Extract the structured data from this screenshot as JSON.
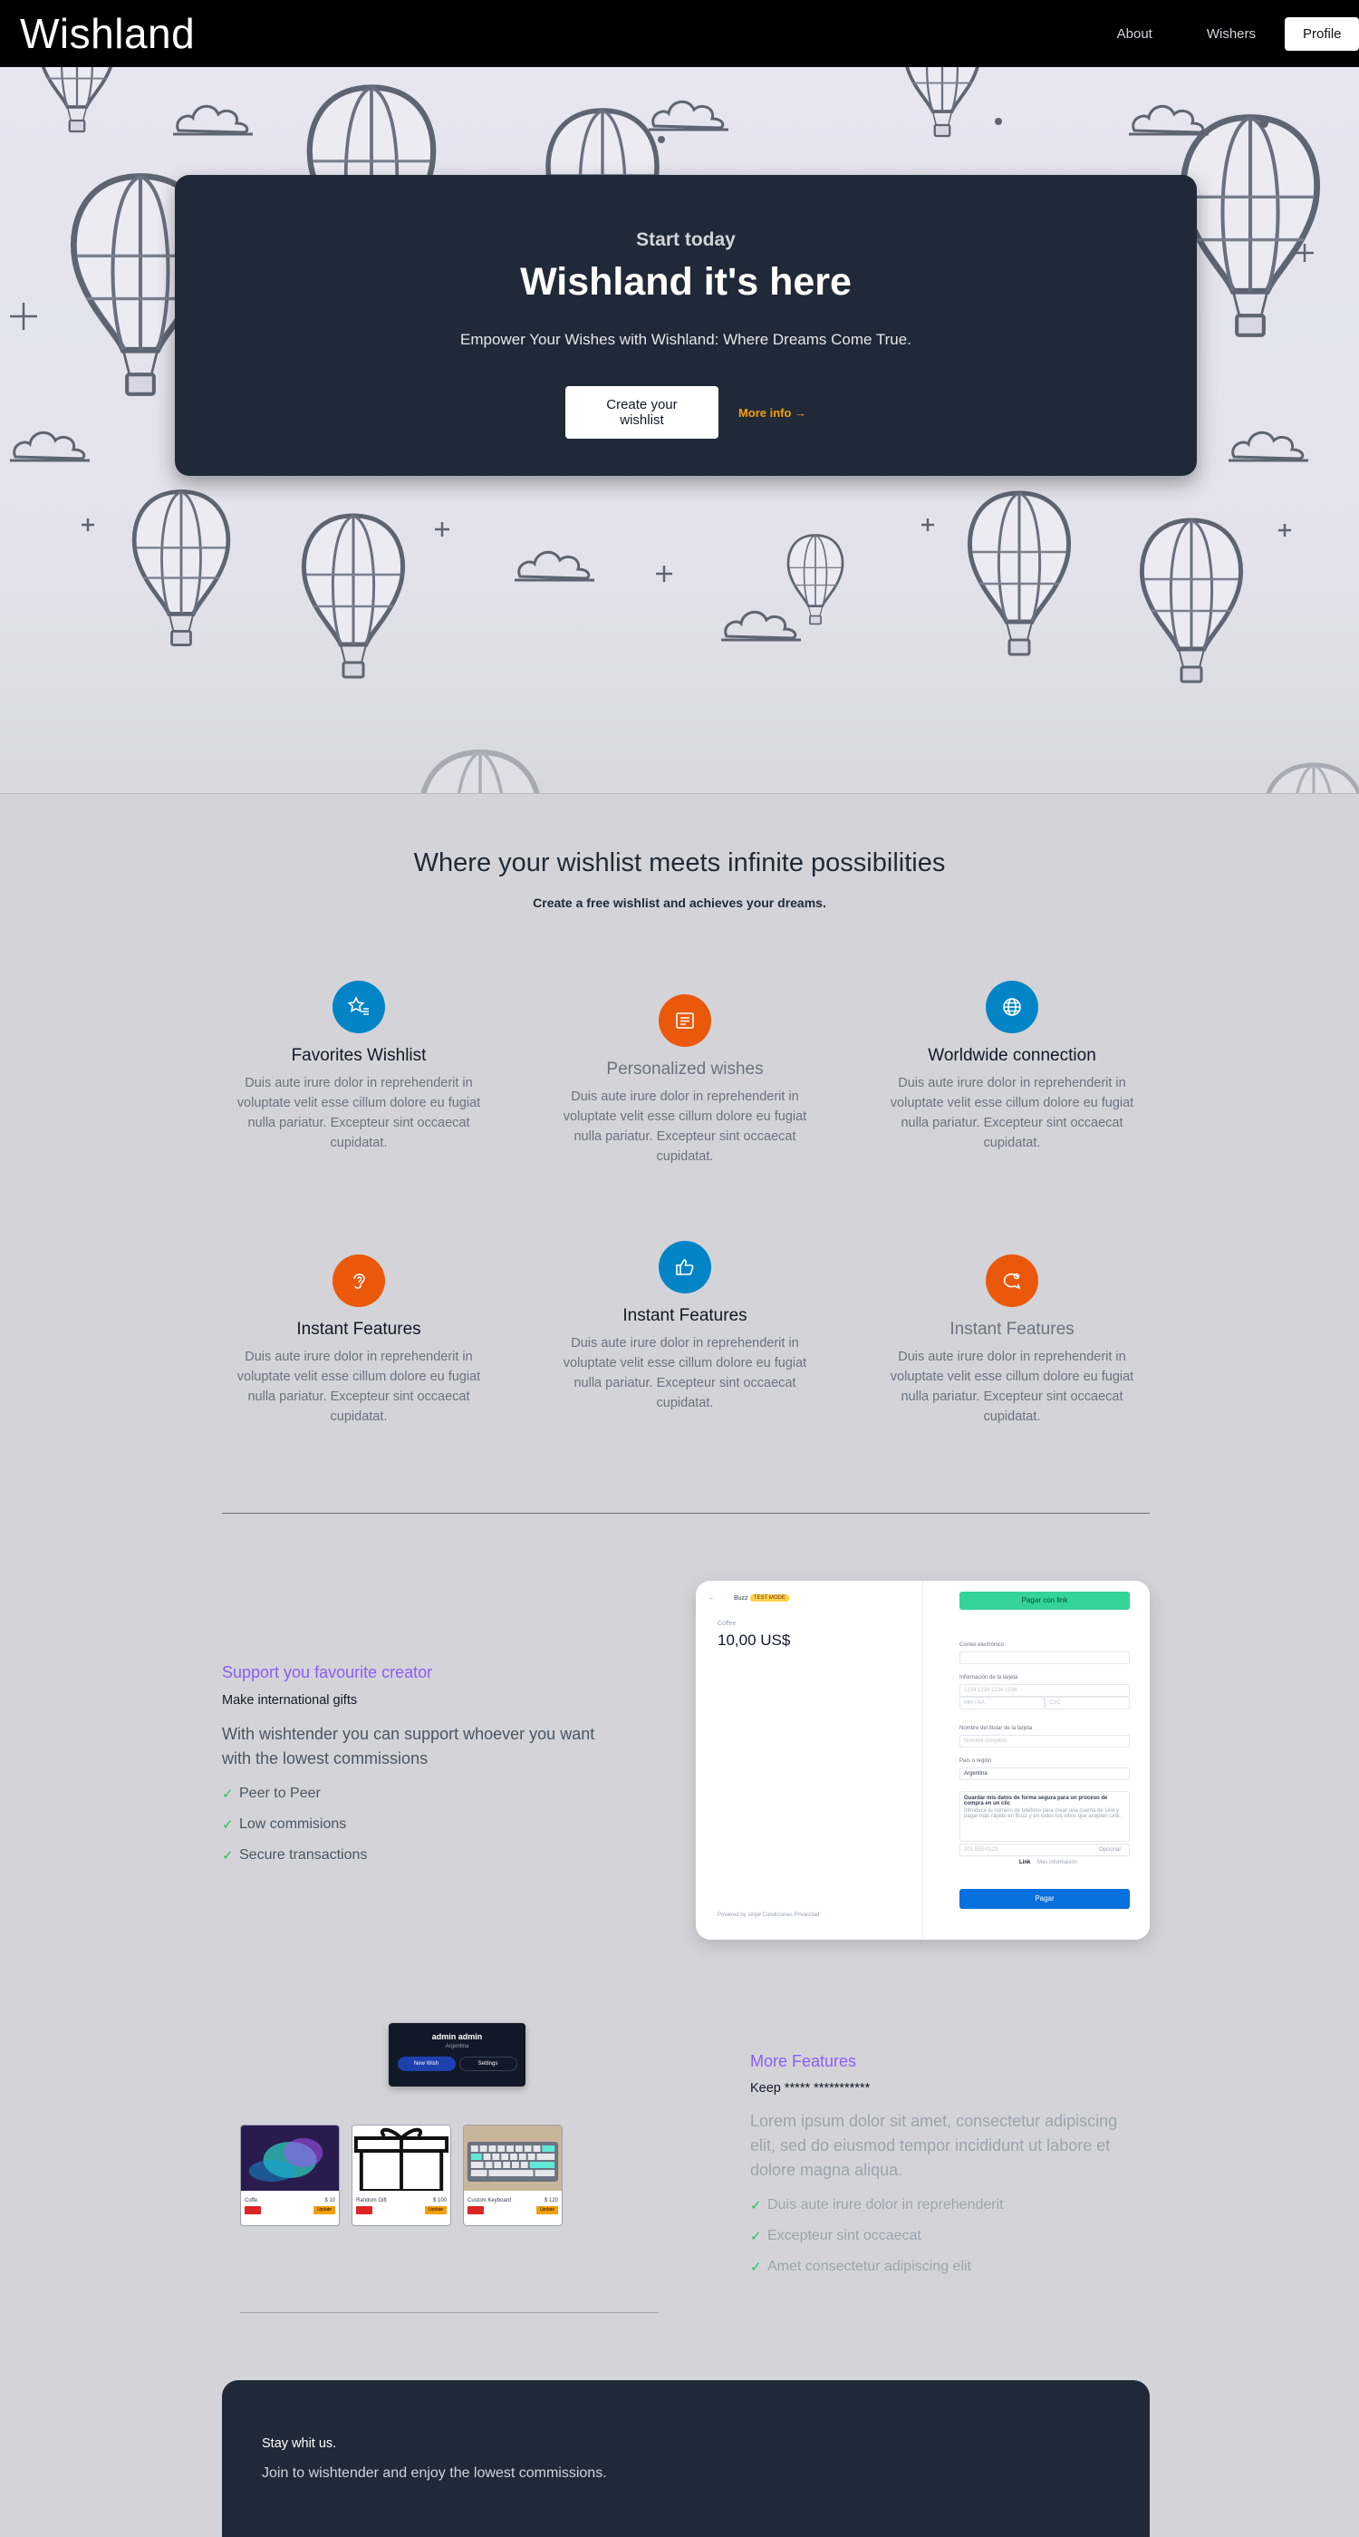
{
  "nav": {
    "logo": "Wishland",
    "links": [
      "About",
      "Wishers"
    ],
    "profile": "Profile"
  },
  "hero": {
    "kicker": "Start today",
    "title": "Wishland it's here",
    "subtitle": "Empower Your Wishes with Wishland: Where Dreams Come True.",
    "primary_cta": "Create your wishlist",
    "secondary_cta": "More info →"
  },
  "possibilities": {
    "title": "Where your wishlist meets infinite possibilities",
    "subtitle": "Create a free wishlist and achieves your dreams.",
    "features": [
      {
        "title": "Favorites Wishlist",
        "icon": "star-list-icon",
        "color": "#0284c7",
        "muted": false,
        "desc": "Duis aute irure dolor in reprehenderit in voluptate velit esse cillum dolore eu fugiat nulla pariatur. Excepteur sint occaecat cupidatat."
      },
      {
        "title": "Personalized wishes",
        "icon": "document-list-icon",
        "color": "#ea580c",
        "muted": true,
        "desc": "Duis aute irure dolor in reprehenderit in voluptate velit esse cillum dolore eu fugiat nulla pariatur. Excepteur sint occaecat cupidatat."
      },
      {
        "title": "Worldwide connection",
        "icon": "globe-icon",
        "color": "#0284c7",
        "muted": false,
        "desc": "Duis aute irure dolor in reprehenderit in voluptate velit esse cillum dolore eu fugiat nulla pariatur. Excepteur sint occaecat cupidatat."
      },
      {
        "title": "Instant Features",
        "icon": "ear-icon",
        "color": "#ea580c",
        "muted": false,
        "desc": "Duis aute irure dolor in reprehenderit in voluptate velit esse cillum dolore eu fugiat nulla pariatur. Excepteur sint occaecat cupidatat."
      },
      {
        "title": "Instant Features",
        "icon": "thumbs-up-icon",
        "color": "#0284c7",
        "muted": false,
        "desc": "Duis aute irure dolor in reprehenderit in voluptate velit esse cillum dolore eu fugiat nulla pariatur. Excepteur sint occaecat cupidatat."
      },
      {
        "title": "Instant Features",
        "icon": "speech-bubble-icon",
        "color": "#ea580c",
        "muted": true,
        "desc": "Duis aute irure dolor in reprehenderit in voluptate velit esse cillum dolore eu fugiat nulla pariatur. Excepteur sint occaecat cupidatat."
      }
    ]
  },
  "creator": {
    "title": "Support you favourite creator",
    "kicker": "Make international gifts",
    "desc": "With wishtender you can support whoever you want with the lowest commissions",
    "checks": [
      "Peer to Peer",
      "Low commisions",
      "Secure transactions"
    ]
  },
  "checkout": {
    "back": "←",
    "merchant": "Buzz",
    "badge": "TEST MODE",
    "product": "Coffee",
    "price": "10,00 US$",
    "link_button": "Pagar con link",
    "email_label": "Correo electrónico",
    "card_label": "Información de la tarjeta",
    "card_placeholder": "1234 1234 1234 1234",
    "mmaa_placeholder": "MM / AA",
    "cvc_placeholder": "CVC",
    "name_label": "Nombre del titular de la tarjeta",
    "name_placeholder": "Nombre completo",
    "country_label": "País o región",
    "country": "Argentina",
    "save_title": "Guardar mis datos de forma segura para un proceso de compra en un clic",
    "save_desc": "Introduce tu número de teléfono para crear una cuenta de Link y pagar más rápido en Buzz y en todos los sitios que acepten Link.",
    "phone_placeholder": "201-555-0123",
    "optional": "Opcional",
    "link_word": "Link",
    "more_info": "Más información",
    "pay": "Pagar",
    "footer": "Powered by stripe   Condiciones   Privacidad"
  },
  "profile_mock": {
    "name": "admin admin",
    "location": "Argentina",
    "tabs": [
      "New Wish",
      "Settings"
    ],
    "wishes": [
      {
        "name": "Coffe",
        "price": "$ 10",
        "action": "Update",
        "image": "aurora-image"
      },
      {
        "name": "Random Gift",
        "price": "$ 100",
        "action": "Update",
        "image": "gift-image"
      },
      {
        "name": "Custom Keyboard",
        "price": "$ 120",
        "action": "Update",
        "image": "keyboard-image"
      }
    ]
  },
  "more": {
    "title": "More Features",
    "kicker": "Keep ***** ***********",
    "desc": "Lorem ipsum dolor sit amet, consectetur adipiscing elit, sed do eiusmod tempor incididunt ut labore et dolore magna aliqua.",
    "checks": [
      "Duis aute irure dolor in reprehenderit",
      "Excepteur sint occaecat",
      "Amet consectetur adipiscing elit"
    ]
  },
  "stay": {
    "kicker": "Stay whit us.",
    "text": "Join to wishtender and enjoy the lowest commissions."
  },
  "colors": {
    "accent_purple": "#8b5cf6",
    "accent_orange": "#f59e0b",
    "blue": "#0284c7",
    "orange": "#ea580c",
    "dark": "#1f2937"
  }
}
